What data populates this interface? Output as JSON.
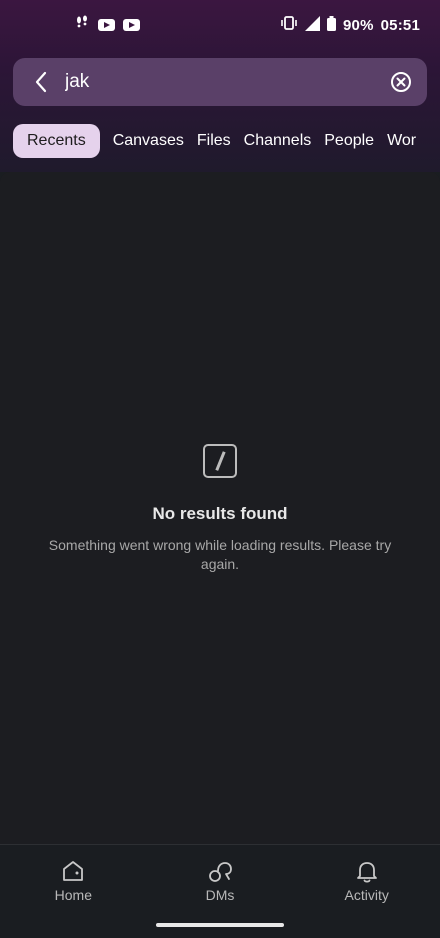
{
  "status_bar": {
    "battery": "90%",
    "time": "05:51",
    "left_icons": [
      "footsteps-icon",
      "youtube-icon",
      "youtube-icon"
    ],
    "right_icons": [
      "vibrate-icon",
      "signal-icon",
      "battery-icon"
    ]
  },
  "search": {
    "query": "jak",
    "back_icon": "chevron-left-icon",
    "clear_icon": "clear-circle-icon"
  },
  "tabs": [
    {
      "label": "Recents",
      "active": true
    },
    {
      "label": "Canvases",
      "active": false
    },
    {
      "label": "Files",
      "active": false
    },
    {
      "label": "Channels",
      "active": false
    },
    {
      "label": "People",
      "active": false
    },
    {
      "label": "Wor",
      "active": false
    }
  ],
  "empty_state": {
    "icon": "slash-square-icon",
    "title": "No results found",
    "message": "Something went wrong while loading results. Please try again."
  },
  "bottom_nav": [
    {
      "label": "Home",
      "icon": "home-icon"
    },
    {
      "label": "DMs",
      "icon": "dms-icon"
    },
    {
      "label": "Activity",
      "icon": "bell-icon"
    }
  ],
  "colors": {
    "header_gradient_top": "#3b1640",
    "search_bg": "#5a4068",
    "tab_active_bg": "#e5d2ec",
    "page_bg": "#1c1d21"
  }
}
